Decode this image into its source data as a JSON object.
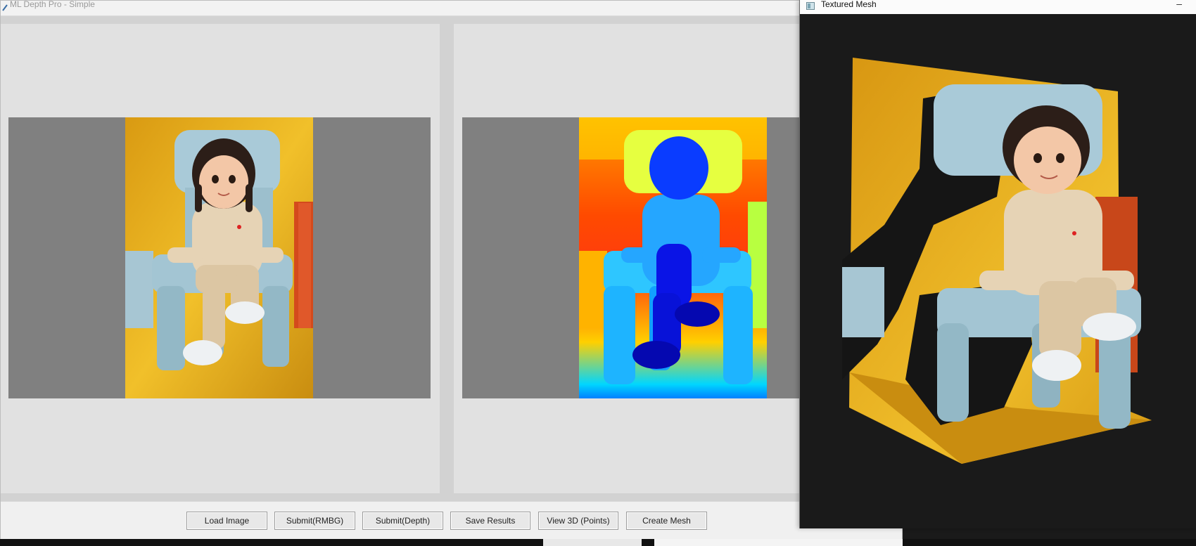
{
  "app": {
    "title": "ML Depth Pro - Simple"
  },
  "buttons": {
    "load_image": "Load Image",
    "submit_rmbg": "Submit(RMBG)",
    "submit_depth": "Submit(Depth)",
    "save_results": "Save Results",
    "view_3d": "View 3D (Points)",
    "create_mesh": "Create Mesh"
  },
  "mesh_window": {
    "title": "Textured Mesh",
    "minimize_glyph": "–"
  },
  "colors": {
    "panel_bg": "#e1e1e1",
    "image_letterbox": "#808080",
    "mesh_bg": "#1a1a1a"
  },
  "icons": {
    "app": "app-icon",
    "mesh_window": "window-icon",
    "minimize": "minimize-icon"
  }
}
